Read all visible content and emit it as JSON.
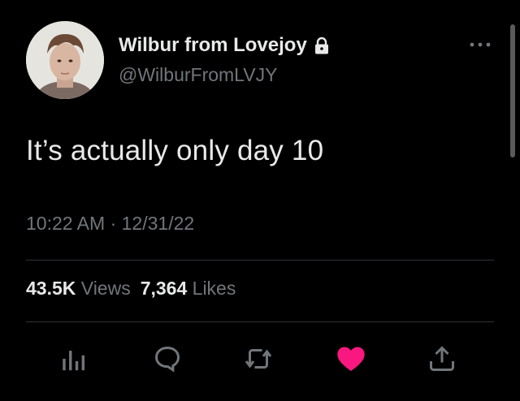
{
  "author": {
    "display_name": "Wilbur from Lovejoy",
    "handle": "@WilburFromLVJY",
    "protected_icon": "lock-icon",
    "avatar": "avatar-photo"
  },
  "tweet": {
    "text": "It’s actually only day 10",
    "time": "10:22 AM",
    "separator": "·",
    "date": "12/31/22"
  },
  "stats": {
    "views_count": "43.5K",
    "views_label": "Views",
    "likes_count": "7,364",
    "likes_label": "Likes"
  },
  "actions": {
    "icons": [
      "analytics-icon",
      "reply-icon",
      "retweet-icon",
      "like-icon",
      "share-icon"
    ],
    "liked": true,
    "like_color": "#f91880"
  },
  "colors": {
    "background": "#000000",
    "text": "#e7e9ea",
    "secondary": "#71767b",
    "divider": "#2f3336"
  }
}
